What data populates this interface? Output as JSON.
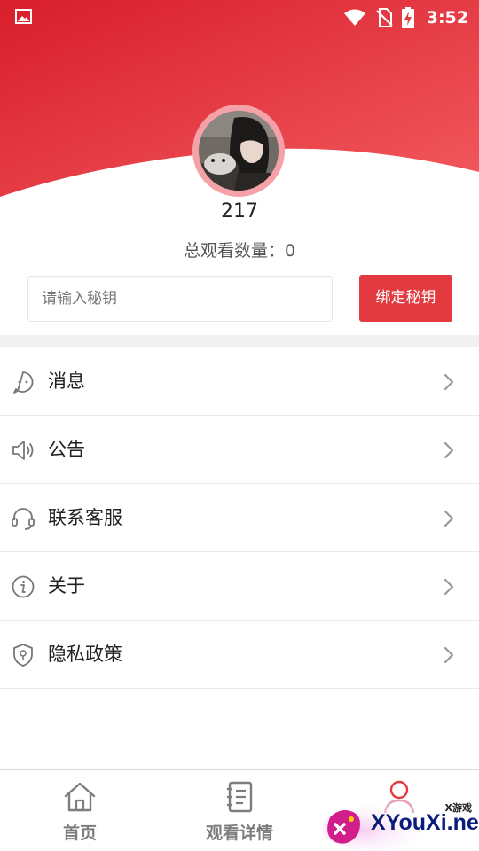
{
  "colors": {
    "brand_red": "#e23a3e",
    "header_gradient_start": "#d81e2c",
    "header_gradient_end": "#f25a5d",
    "avatar_ring": "#f4a2a8",
    "divider": "#e8e8e8",
    "tab_inactive": "#7d7d7d",
    "tab_active": "#e23a3e"
  },
  "status_bar": {
    "time": "3:52",
    "icons": [
      "image-icon",
      "wifi-icon",
      "no-sim-icon",
      "battery-charging-icon"
    ]
  },
  "profile": {
    "username": "217",
    "view_count_text": "总观看数量：0"
  },
  "key_form": {
    "placeholder": "请输入秘钥",
    "value": "",
    "bind_button": "绑定秘钥"
  },
  "menu": {
    "items": [
      {
        "label": "消息",
        "icon": "message-bubble-icon"
      },
      {
        "label": "公告",
        "icon": "speaker-icon"
      },
      {
        "label": "联系客服",
        "icon": "headset-icon"
      },
      {
        "label": "关于",
        "icon": "info-icon"
      },
      {
        "label": "隐私政策",
        "icon": "shield-icon"
      }
    ]
  },
  "tabbar": {
    "tabs": [
      {
        "label": "首页",
        "icon": "home-icon",
        "active": false
      },
      {
        "label": "观看详情",
        "icon": "notebook-icon",
        "active": false
      },
      {
        "label": "",
        "icon": "profile-icon",
        "active": true
      }
    ]
  },
  "watermark": {
    "small": "X游戏",
    "text": "XYouXi.net"
  }
}
